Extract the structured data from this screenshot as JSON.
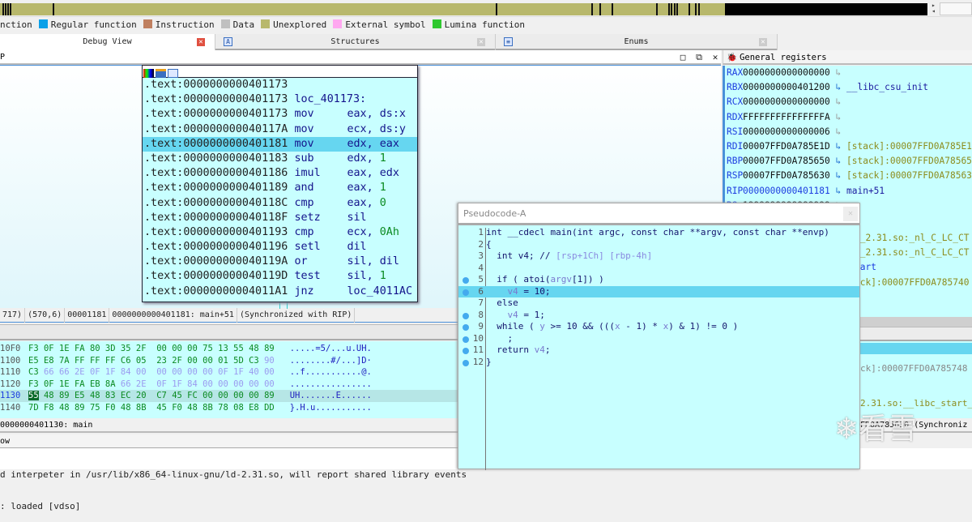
{
  "legend": [
    {
      "label": "nction",
      "color": ""
    },
    {
      "label": "Regular function",
      "color": "#0aa0e8"
    },
    {
      "label": "Instruction",
      "color": "#c08060"
    },
    {
      "label": "Data",
      "color": "#c0c0c0"
    },
    {
      "label": "Unexplored",
      "color": "#b8b86c"
    },
    {
      "label": "External symbol",
      "color": "#ffa8f0"
    },
    {
      "label": "Lumina function",
      "color": "#30c830"
    }
  ],
  "tabs": [
    {
      "label": "Debug View",
      "active": true
    },
    {
      "label": "Structures"
    },
    {
      "label": "Enums"
    }
  ],
  "ida_view": {
    "title_fragment": "P"
  },
  "disasm": [
    {
      "addr": ".text:0000000000401173",
      "mnem": "",
      "op": "",
      "num": ""
    },
    {
      "addr": ".text:0000000000401173",
      "mnem": "loc_401173:",
      "op": "",
      "num": ""
    },
    {
      "addr": ".text:0000000000401173",
      "mnem": "mov",
      "op": "eax, ds:x",
      "num": ""
    },
    {
      "addr": ".text:000000000040117A",
      "mnem": "mov",
      "op": "ecx, ds:y",
      "num": ""
    },
    {
      "addr": ".text:0000000000401181",
      "mnem": "mov",
      "op": "edx, eax",
      "num": "",
      "current": true
    },
    {
      "addr": ".text:0000000000401183",
      "mnem": "sub",
      "op": "edx, ",
      "num": "1"
    },
    {
      "addr": ".text:0000000000401186",
      "mnem": "imul",
      "op": "eax, edx",
      "num": ""
    },
    {
      "addr": ".text:0000000000401189",
      "mnem": "and",
      "op": "eax, ",
      "num": "1"
    },
    {
      "addr": ".text:000000000040118C",
      "mnem": "cmp",
      "op": "eax, ",
      "num": "0"
    },
    {
      "addr": ".text:000000000040118F",
      "mnem": "setz",
      "op": "sil",
      "num": ""
    },
    {
      "addr": ".text:0000000000401193",
      "mnem": "cmp",
      "op": "ecx, ",
      "num": "0Ah"
    },
    {
      "addr": ".text:0000000000401196",
      "mnem": "setl",
      "op": "dil",
      "num": ""
    },
    {
      "addr": ".text:000000000040119A",
      "mnem": "or",
      "op": "sil, dil",
      "num": ""
    },
    {
      "addr": ".text:000000000040119D",
      "mnem": "test",
      "op": "sil, ",
      "num": "1"
    },
    {
      "addr": ".text:00000000004011A1",
      "mnem": "jnz",
      "op": "loc_4011AC",
      "num": ""
    }
  ],
  "status1": [
    "717)",
    "(570,6)",
    "00001181",
    "0000000000401181: main+51",
    "(Synchronized with RIP)"
  ],
  "hex": [
    {
      "addr": "10F0",
      "bytes": [
        "F3",
        "0F",
        "1E",
        "FA",
        "80",
        "3D",
        "35",
        "2F",
        "00",
        "00",
        "00",
        "75",
        "13",
        "55",
        "48",
        "89"
      ],
      "code": 16,
      "ascii": ".....=5/...u.UH."
    },
    {
      "addr": "1100",
      "bytes": [
        "E5",
        "E8",
        "7A",
        "FF",
        "FF",
        "FF",
        "C6",
        "05",
        "23",
        "2F",
        "00",
        "00",
        "01",
        "5D",
        "C3",
        "90"
      ],
      "code": 15,
      "ascii": "........#/...]D·"
    },
    {
      "addr": "1110",
      "bytes": [
        "C3",
        "66",
        "66",
        "2E",
        "0F",
        "1F",
        "84",
        "00",
        "00",
        "00",
        "00",
        "00",
        "0F",
        "1F",
        "40",
        "00"
      ],
      "code": 1,
      "ascii": "..f...........@."
    },
    {
      "addr": "1120",
      "bytes": [
        "F3",
        "0F",
        "1E",
        "FA",
        "EB",
        "8A",
        "66",
        "2E",
        "0F",
        "1F",
        "84",
        "00",
        "00",
        "00",
        "00",
        "00"
      ],
      "code": 6,
      "ascii": "................"
    },
    {
      "addr": "1130",
      "bytes": [
        "55",
        "48",
        "89",
        "E5",
        "48",
        "83",
        "EC",
        "20",
        "C7",
        "45",
        "FC",
        "00",
        "00",
        "00",
        "00",
        "89"
      ],
      "code": 16,
      "ascii": "UH.......E......",
      "current": true
    },
    {
      "addr": "1140",
      "bytes": [
        "7D",
        "F8",
        "48",
        "89",
        "75",
        "F0",
        "48",
        "8B",
        "45",
        "F0",
        "48",
        "8B",
        "78",
        "08",
        "E8",
        "DD"
      ],
      "code": 16,
      "ascii": "}.H.u..........."
    }
  ],
  "status2": "0000000401130: main",
  "output": {
    "title_fragment": "ow",
    "lines": [
      "d interpeter in /usr/lib/x86_64-linux-gnu/ld-2.31.so, will report shared library events",
      ": loaded [vdso]"
    ]
  },
  "registers": {
    "title": "General registers",
    "rows": [
      {
        "name": "RAX",
        "value": "0000000000000000",
        "ref": "",
        "kind": ""
      },
      {
        "name": "RBX",
        "value": "0000000000401200",
        "ref": "__libc_csu_init",
        "kind": "sym"
      },
      {
        "name": "RCX",
        "value": "0000000000000000",
        "ref": "",
        "kind": ""
      },
      {
        "name": "RDX",
        "value": "FFFFFFFFFFFFFFFA",
        "ref": "",
        "kind": ""
      },
      {
        "name": "RSI",
        "value": "0000000000000006",
        "ref": "",
        "kind": ""
      },
      {
        "name": "RDI",
        "value": "00007FFD0A785E1D",
        "ref": "[stack]:00007FFD0A785E1D",
        "kind": "stack"
      },
      {
        "name": "RBP",
        "value": "00007FFD0A785650",
        "ref": "[stack]:00007FFD0A785650",
        "kind": "stack"
      },
      {
        "name": "RSP",
        "value": "00007FFD0A785630",
        "ref": "[stack]:00007FFD0A785630",
        "kind": "stack"
      },
      {
        "name": "RIP",
        "value": "0000000000401181",
        "ref": "main+51",
        "kind": "sym"
      },
      {
        "name": "R8",
        "value": "1999999999999999",
        "ref": "",
        "kind": ""
      }
    ],
    "hidden_refs": [
      "c_2.31.so:_nl_C_LC_CT",
      "c_2.31.so:_nl_C_LC_CT",
      "tart",
      "ack]:00007FFD0A785740"
    ]
  },
  "stack": {
    "lines": [
      "ck]:00007FFD0A785748",
      "2.31.so:__libc_start_"
    ],
    "status": "FD0A785630 (Synchroniz"
  },
  "pseudocode": {
    "title": "Pseudocode-A",
    "lines": [
      {
        "n": "1",
        "dot": false,
        "seg": [
          {
            "t": "int __cdecl main(int argc, const char **argv, const char **envp)",
            "c": ""
          }
        ]
      },
      {
        "n": "2",
        "dot": false,
        "seg": [
          {
            "t": "{",
            "c": ""
          }
        ]
      },
      {
        "n": "3",
        "dot": false,
        "seg": [
          {
            "t": "  int v4; // ",
            "c": ""
          },
          {
            "t": "[rsp+1Ch] [rbp-4h]",
            "c": "cm"
          }
        ]
      },
      {
        "n": "4",
        "dot": false,
        "seg": []
      },
      {
        "n": "5",
        "dot": true,
        "seg": [
          {
            "t": "  if ( atoi(",
            "c": ""
          },
          {
            "t": "argv",
            "c": "v"
          },
          {
            "t": "[1]) )",
            "c": ""
          }
        ]
      },
      {
        "n": "6",
        "dot": true,
        "current": true,
        "seg": [
          {
            "t": "    ",
            "c": ""
          },
          {
            "t": "v4",
            "c": "v"
          },
          {
            "t": " = 10;",
            "c": ""
          }
        ]
      },
      {
        "n": "7",
        "dot": false,
        "seg": [
          {
            "t": "  else",
            "c": ""
          }
        ]
      },
      {
        "n": "8",
        "dot": true,
        "seg": [
          {
            "t": "    ",
            "c": ""
          },
          {
            "t": "v4",
            "c": "v"
          },
          {
            "t": " = 1;",
            "c": ""
          }
        ]
      },
      {
        "n": "9",
        "dot": true,
        "seg": [
          {
            "t": "  while ( ",
            "c": ""
          },
          {
            "t": "y",
            "c": "v"
          },
          {
            "t": " >= 10 && (((",
            "c": ""
          },
          {
            "t": "x",
            "c": "v"
          },
          {
            "t": " - 1) * ",
            "c": ""
          },
          {
            "t": "x",
            "c": "v"
          },
          {
            "t": ") & 1) != 0 )",
            "c": ""
          }
        ]
      },
      {
        "n": "10",
        "dot": true,
        "seg": [
          {
            "t": "    ;",
            "c": ""
          }
        ]
      },
      {
        "n": "11",
        "dot": true,
        "seg": [
          {
            "t": "  return ",
            "c": ""
          },
          {
            "t": "v4",
            "c": "v"
          },
          {
            "t": ";",
            "c": ""
          }
        ]
      },
      {
        "n": "12",
        "dot": true,
        "seg": [
          {
            "t": "}",
            "c": ""
          }
        ]
      }
    ]
  },
  "watermark": "❄看雪"
}
